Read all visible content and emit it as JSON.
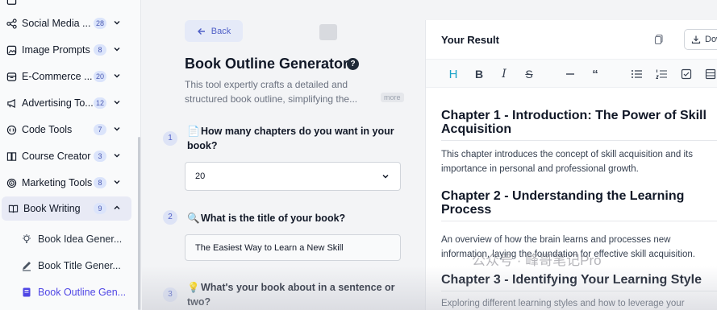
{
  "sidebar": {
    "items": [
      {
        "label": "Social Media ...",
        "badge": "28",
        "icon": "share-icon"
      },
      {
        "label": "Image Prompts",
        "badge": "8",
        "icon": "image-icon"
      },
      {
        "label": "E-Commerce ...",
        "badge": "20",
        "icon": "store-icon"
      },
      {
        "label": "Advertising To...",
        "badge": "12",
        "icon": "megaphone-icon"
      },
      {
        "label": "Code Tools",
        "badge": "7",
        "icon": "code-icon"
      },
      {
        "label": "Course Creator",
        "badge": "3",
        "icon": "course-icon"
      },
      {
        "label": "Marketing Tools",
        "badge": "8",
        "icon": "target-icon"
      },
      {
        "label": "Book Writing",
        "badge": "9",
        "icon": "book-icon"
      }
    ],
    "subitems": [
      {
        "label": "Book Idea Gener...",
        "icon": "lightbulb-icon"
      },
      {
        "label": "Book Title Gener...",
        "icon": "pencil-icon"
      },
      {
        "label": "Book Outline Gen...",
        "icon": "notebook-icon"
      }
    ]
  },
  "main": {
    "back_label": "Back",
    "title": "Book Outline Generator",
    "description": "This tool expertly crafts a detailed and structured book outline, simplifying the...",
    "more_label": "more",
    "questions": [
      {
        "num": "1",
        "icon": "📄",
        "text": "How many chapters do you want in your book?",
        "value": "20"
      },
      {
        "num": "2",
        "icon": "🔍",
        "text": "What is the title of your book?",
        "value": "The Easiest Way to Learn a New Skill"
      },
      {
        "num": "3",
        "icon": "💡",
        "text": "What's your book about in a sentence or two?"
      }
    ]
  },
  "result": {
    "title": "Your Result",
    "download_label": "Dow",
    "chapters": [
      {
        "heading": "Chapter 1 - Introduction: The Power of Skill Acquisition",
        "lines": [
          "This chapter introduces the concept of skill acquisition and its",
          "importance in personal and professional growth."
        ]
      },
      {
        "heading": "Chapter 2 - Understanding the Learning Process",
        "lines": [
          "An overview of how the brain learns and processes new",
          "information, laying the foundation for effective skill acquisition."
        ]
      },
      {
        "heading": "Chapter 3 - Identifying Your Learning Style",
        "lines": [
          "Exploring different learning styles and how to leverage your"
        ]
      }
    ]
  },
  "watermark": "公众号 · 峰哥笔记Pro",
  "colors": {
    "accent": "#4f46e5",
    "badge_bg": "#dbe4fb",
    "active_bg": "#e8eaf5"
  }
}
